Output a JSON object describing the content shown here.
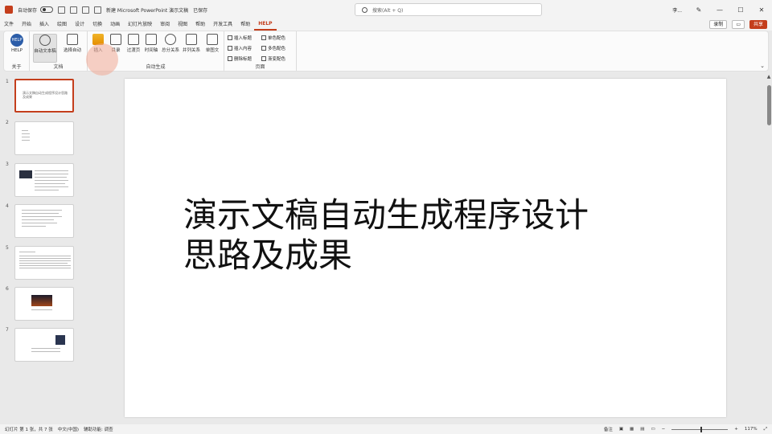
{
  "titlebar": {
    "autosave_label": "自动保存",
    "filename": "新建 Microsoft PowerPoint 演示文稿",
    "saved_state": "已保存",
    "search_placeholder": "搜索(Alt + Q)",
    "user_name": "李..."
  },
  "tabs": [
    "文件",
    "开始",
    "插入",
    "绘图",
    "设计",
    "切换",
    "动画",
    "幻灯片放映",
    "审阅",
    "视图",
    "帮助",
    "开发工具",
    "帮助",
    "HELP"
  ],
  "active_tab_index": 13,
  "tab_right": {
    "record_label": "录制",
    "share_label": "共享"
  },
  "ribbon": {
    "groups": [
      {
        "label": "关于",
        "buttons": [
          "HELP"
        ]
      },
      {
        "label": "文档",
        "buttons": [
          "自动文本稿",
          "选择自动"
        ]
      },
      {
        "label": "自动生成",
        "buttons": [
          "插入",
          "目录",
          "过渡页",
          "时间轴",
          "总分关系",
          "并列关系",
          "单图文"
        ]
      },
      {
        "label": "页面",
        "buttons": [
          "插入标题",
          "插入内容",
          "删除标题",
          "单色配色",
          "多色配色",
          "渐变配色"
        ]
      }
    ],
    "help_icon_text": "HELP"
  },
  "slides": [
    {
      "number": "1",
      "title": "演示文稿自动生成程序设计思路及成果"
    },
    {
      "number": "2",
      "title": ""
    },
    {
      "number": "3",
      "title": ""
    },
    {
      "number": "4",
      "title": ""
    },
    {
      "number": "5",
      "title": ""
    },
    {
      "number": "6",
      "title": ""
    },
    {
      "number": "7",
      "title": ""
    }
  ],
  "current_slide": {
    "title": "演示文稿自动生成程序设计思路及成果"
  },
  "statusbar": {
    "slide_info": "幻灯片 第 1 张，共 7 张",
    "language": "中文(中国)",
    "accessibility": "辅助功能: 调查",
    "notes_label": "备注",
    "zoom": "117%"
  },
  "colors": {
    "accent": "#c43e1c",
    "help_blue": "#2c5da8"
  }
}
